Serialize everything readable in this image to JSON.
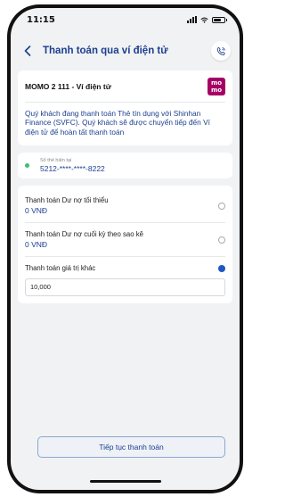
{
  "status_bar": {
    "time": "11:15"
  },
  "header": {
    "title": "Thanh toán qua ví điện tử"
  },
  "merchant": {
    "name": "MOMO 2 111 - Ví điện tử",
    "logo_text": "mo mo",
    "notice": "Quý khách đang thanh toán Thẻ tín dụng với Shinhan Finance (SVFC). Quý khách sẽ được chuyển tiếp đến Ví điện tử để hoàn tất thanh toán"
  },
  "card": {
    "label": "Số thẻ hiện tại",
    "number": "5212-****-****-8222"
  },
  "options": [
    {
      "label": "Thanh toán Dư nợ tối thiểu",
      "value": "0 VNĐ",
      "selected": false
    },
    {
      "label": "Thanh toán Dư nợ cuối kỳ theo sao kê",
      "value": "0 VNĐ",
      "selected": false
    },
    {
      "label": "Thanh toán giá trị khác",
      "value": "",
      "selected": true
    }
  ],
  "other_amount": {
    "value": "10,000"
  },
  "continue_button": {
    "label": "Tiếp tục thanh toán"
  },
  "colors": {
    "primary": "#1b3f8f",
    "radio_selected": "#1f57c3",
    "momo": "#a50064",
    "card_dot": "#38c172",
    "background": "#f1f2f4"
  },
  "icons": {
    "back": "chevron-left-icon",
    "support": "phone-support-icon"
  }
}
